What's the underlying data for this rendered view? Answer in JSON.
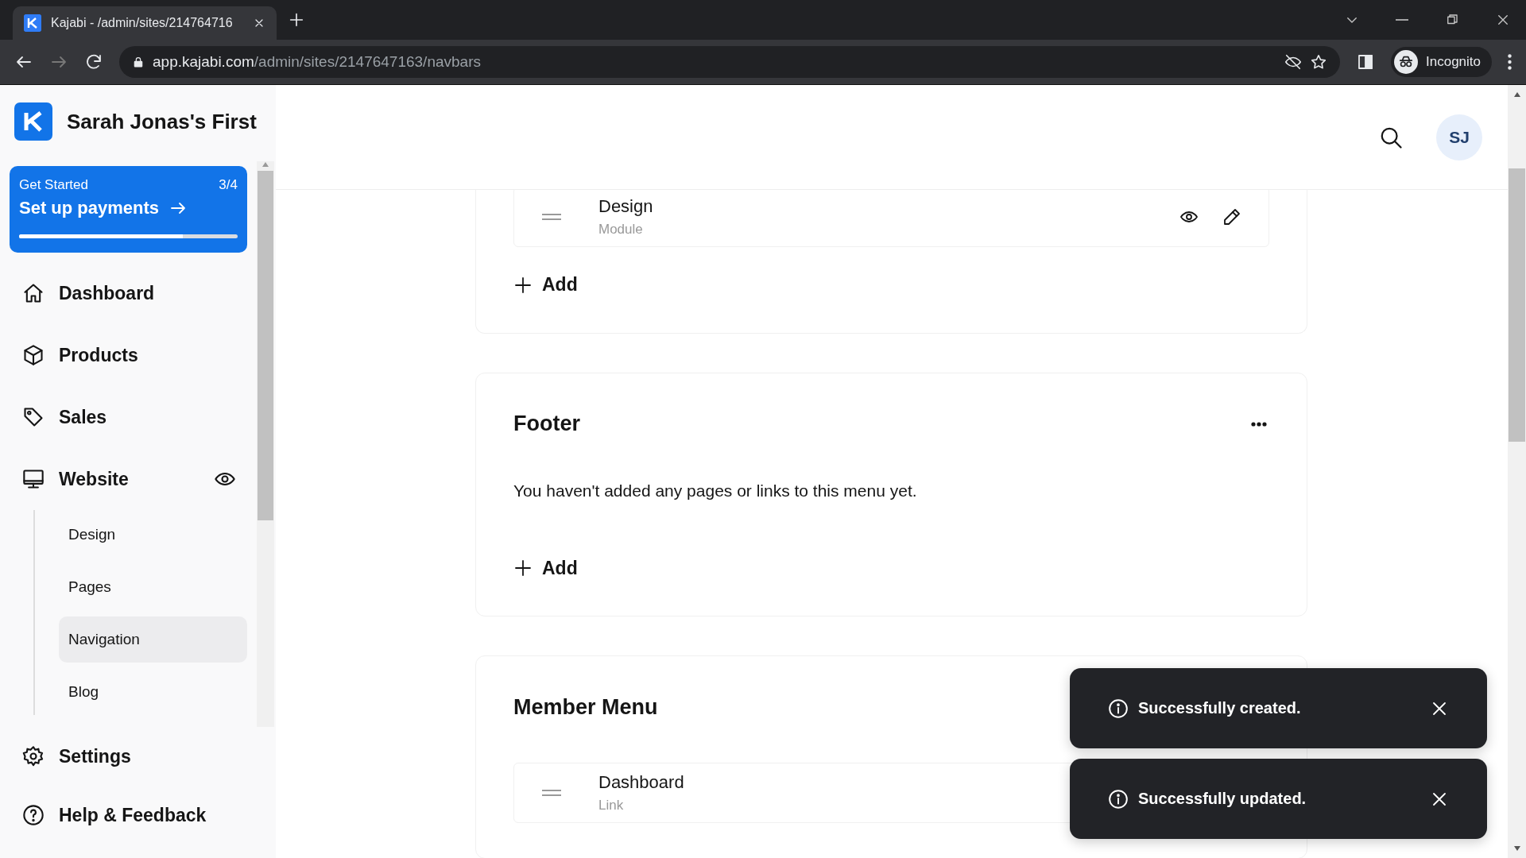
{
  "browser": {
    "tab_title": "Kajabi - /admin/sites/214764716",
    "url_host": "app.kajabi.com",
    "url_path": "/admin/sites/2147647163/navbars",
    "profile": "Incognito"
  },
  "sidebar": {
    "site_name": "Sarah Jonas's First",
    "get_started": {
      "label": "Get Started",
      "count": "3/4",
      "title": "Set up payments",
      "level": 0.75
    },
    "nav": [
      {
        "label": "Dashboard",
        "selected": false
      },
      {
        "label": "Products",
        "selected": false
      },
      {
        "label": "Sales",
        "selected": false
      },
      {
        "label": "Website",
        "selected": false,
        "preview": true,
        "children": [
          {
            "label": "Design",
            "selected": false
          },
          {
            "label": "Pages",
            "selected": false
          },
          {
            "label": "Navigation",
            "selected": true
          },
          {
            "label": "Blog",
            "selected": false
          }
        ]
      }
    ],
    "footer_nav": [
      {
        "label": "Settings",
        "selected": false
      },
      {
        "label": "Help & Feedback",
        "selected": false
      }
    ]
  },
  "header": {
    "avatar": "SJ"
  },
  "menus": [
    {
      "items": [
        {
          "title": "Design",
          "type": "Module",
          "actions": true
        }
      ],
      "add_label": "Add"
    },
    {
      "title": "Footer",
      "empty_message": "You haven't added any pages or links to this menu yet.",
      "add_label": "Add"
    },
    {
      "title": "Member Menu",
      "items": [
        {
          "title": "Dashboard",
          "type": "Link",
          "actions": false
        }
      ]
    }
  ],
  "toasts": [
    {
      "message": "Successfully created."
    },
    {
      "message": "Successfully updated."
    }
  ]
}
